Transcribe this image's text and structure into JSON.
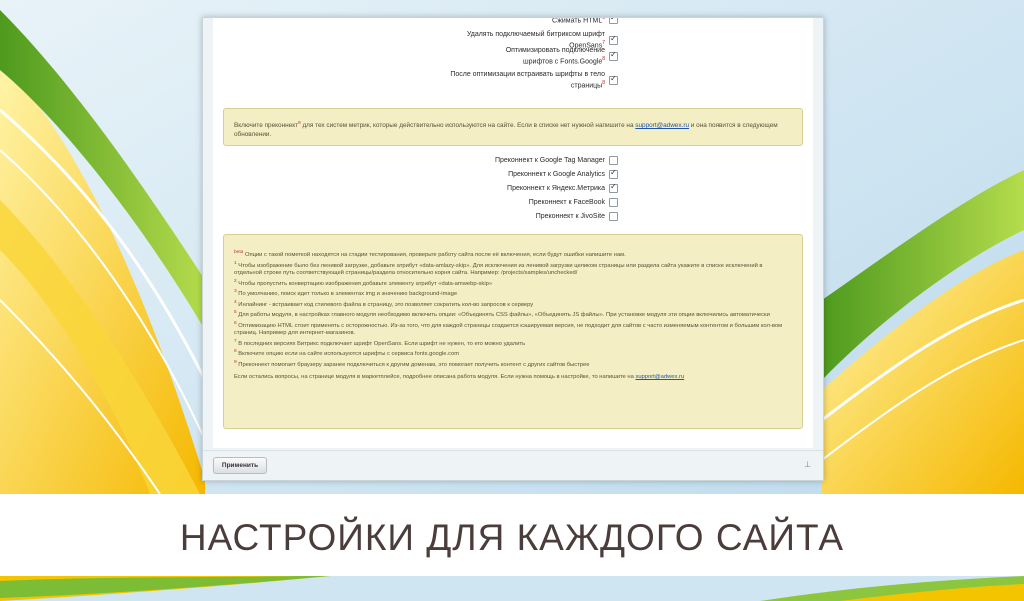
{
  "options_top": [
    {
      "label": "Сжимать HTML",
      "mark": "6",
      "checked": true
    },
    {
      "label": "Удалять подключаемый битриксом шрифт OpenSans",
      "mark": "7",
      "checked": true
    },
    {
      "label": "Оптимизировать подключение шрифтов с Fonts.Google",
      "mark": "8",
      "checked": true
    },
    {
      "label": "После оптимизации встраивать шрифты в тело страницы",
      "mark": "8",
      "checked": true
    }
  ],
  "preconnect_notice": {
    "prefix": "Включите преконнект",
    "mark": "9",
    "middle": " для тех систем метрик, которые действительно используются на сайте. Если в списке нет нужной напишите на ",
    "email": "support@adwex.ru",
    "suffix": " и она появится в следующем обновлении."
  },
  "preconnect_options": [
    {
      "label": "Преконнект к Google Tag Manager",
      "checked": false
    },
    {
      "label": "Преконнект к Google Analytics",
      "checked": true
    },
    {
      "label": "Преконнект к Яндекс.Метрика",
      "checked": true
    },
    {
      "label": "Преконнект к FaceBook",
      "checked": false
    },
    {
      "label": "Преконнект к JivoSite",
      "checked": false
    }
  ],
  "notes": [
    {
      "mark": "beta",
      "text": "Опции с такой пометкой находятся на стадии тестирования, проверьте работу сайта после её включения, если будут ошибки напишите нам."
    },
    {
      "mark": "1",
      "text": "Чтобы изображение было без ленивой загрузке, добавьте атрибут «data-amlazy-skip». Для исключения из ленивой загрузки целиком страницы или раздела сайта укажите в списке исключений в отдельной строке путь соответствующей страницы/раздела относительно корня сайта. Например: /projects/samples/unchecked/"
    },
    {
      "mark": "2",
      "text": "Чтобы пропустить конвертацию изображения добавьте элементу атрибут «data-amwebp-skip»"
    },
    {
      "mark": "3",
      "text": "По умолчанию, поиск идет только в элементах img и значению background-image"
    },
    {
      "mark": "4",
      "text": "Инлайнинг - встраивает код стилевого файла в страницу, это позволяет сократить кол-во запросов к серверу"
    },
    {
      "mark": "5",
      "text": "Для работы модуля, в настройках главного модуля необходимо включить опции: «Объединять CSS файлы», «Объединять JS файлы». При установке модуля эти опции включились автоматически"
    },
    {
      "mark": "6",
      "text": "Оптимизацию HTML стоит применять с осторожностью. Из-за того, что для каждой страницы создается кэшируемая версия, не подходит для сайтов с часто изменяемым контентом и большим кол-вом страниц. Например для интернет-магазинов."
    },
    {
      "mark": "7",
      "text": "В последних версиях Битрикс подключает шрифт OpenSans. Если шрифт не нужен, то его можно удалить"
    },
    {
      "mark": "8",
      "text": "Включите опцию если на сайте используются шрифты с сервиса fonts.google.com"
    },
    {
      "mark": "9",
      "text": "Преконнект помогает браузеру заранее подключиться к другим доменам, это помогает получить контент с других сайтов быстрее"
    }
  ],
  "help_line": {
    "text": "Если остались вопросы, на странице модуля в маркетплейсе, подробнее описана работа модуля. Если нужна помощь в настройке, то напишите на ",
    "email": "support@adwex.ru"
  },
  "footer": {
    "apply_label": "Применить",
    "pin_icon": "pin-icon"
  },
  "banner": {
    "title": "НАСТРОЙКИ ДЛЯ КАЖДОГО САЙТА"
  },
  "colors": {
    "accent_green": "#8cc63f",
    "accent_yellow": "#f7c600",
    "notice_bg": "#f3eec4",
    "banner_text": "#4a3d3b"
  }
}
